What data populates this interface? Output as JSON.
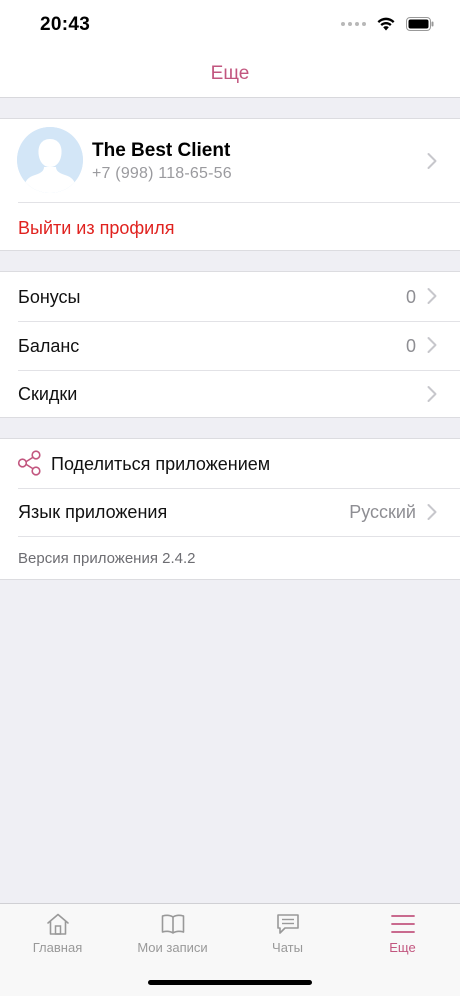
{
  "status_bar": {
    "time": "20:43"
  },
  "nav": {
    "title": "Еще"
  },
  "profile": {
    "name": "The Best Client",
    "phone": "+7 (998) 118-65-56",
    "logout_label": "Выйти из профиля"
  },
  "account": {
    "bonuses": {
      "label": "Бонусы",
      "value": "0"
    },
    "balance": {
      "label": "Баланс",
      "value": "0"
    },
    "discounts": {
      "label": "Скидки"
    }
  },
  "app": {
    "share_label": "Поделиться приложением",
    "language": {
      "label": "Язык приложения",
      "value": "Русский"
    },
    "version": "Версия приложения 2.4.2"
  },
  "tabs": [
    {
      "label": "Главная",
      "icon": "home-icon"
    },
    {
      "label": "Мои записи",
      "icon": "book-icon"
    },
    {
      "label": "Чаты",
      "icon": "chat-icon"
    },
    {
      "label": "Еще",
      "icon": "menu-icon"
    }
  ],
  "colors": {
    "accent": "#c2567f",
    "destructive": "#e0221f",
    "background": "#efeff4"
  }
}
